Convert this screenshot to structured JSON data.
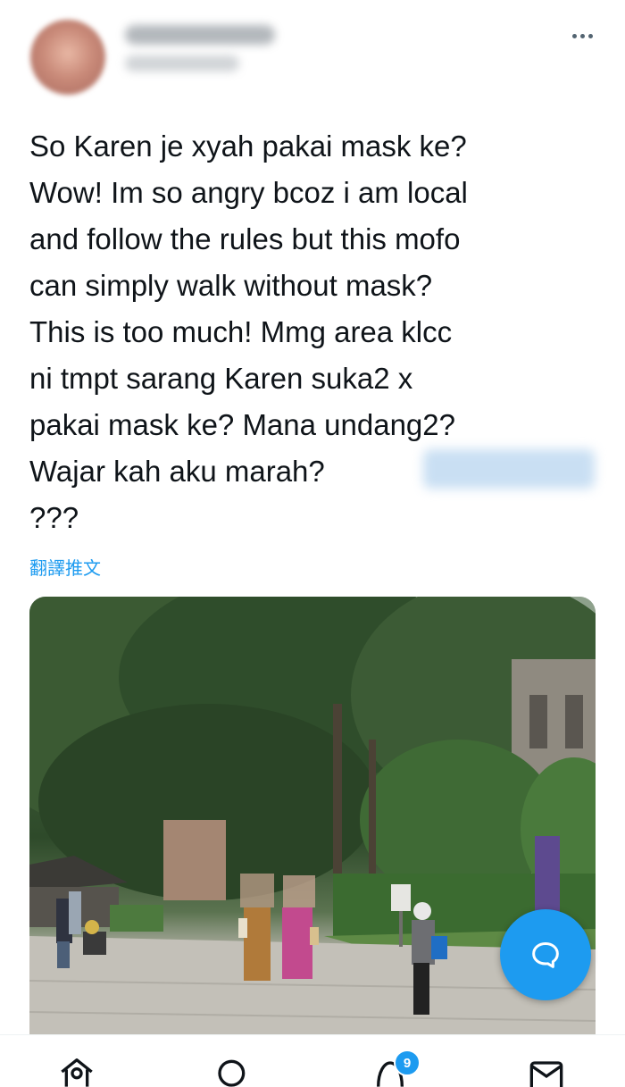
{
  "tweet": {
    "text": "So Karen je xyah pakai mask ke?\nWow! Im so angry bcoz i am local\nand follow the rules but this mofo\ncan simply walk without mask?\nThis is too much! Mmg area klcc\nni tmpt sarang Karen suka2 x\npakai mask ke? Mana undang2?\nWajar kah aku marah?\n???",
    "translate_label": "翻譯推文"
  },
  "tabbar": {
    "notifications_badge": "9"
  },
  "icons": {
    "more": "more-horizontal-icon",
    "reply": "reply-bubble-icon",
    "home": "home-icon",
    "search": "search-icon",
    "notifications": "bell-icon",
    "messages": "mail-icon"
  },
  "colors": {
    "accent": "#1d9bf0",
    "text": "#0f1419",
    "muted": "#536471"
  }
}
